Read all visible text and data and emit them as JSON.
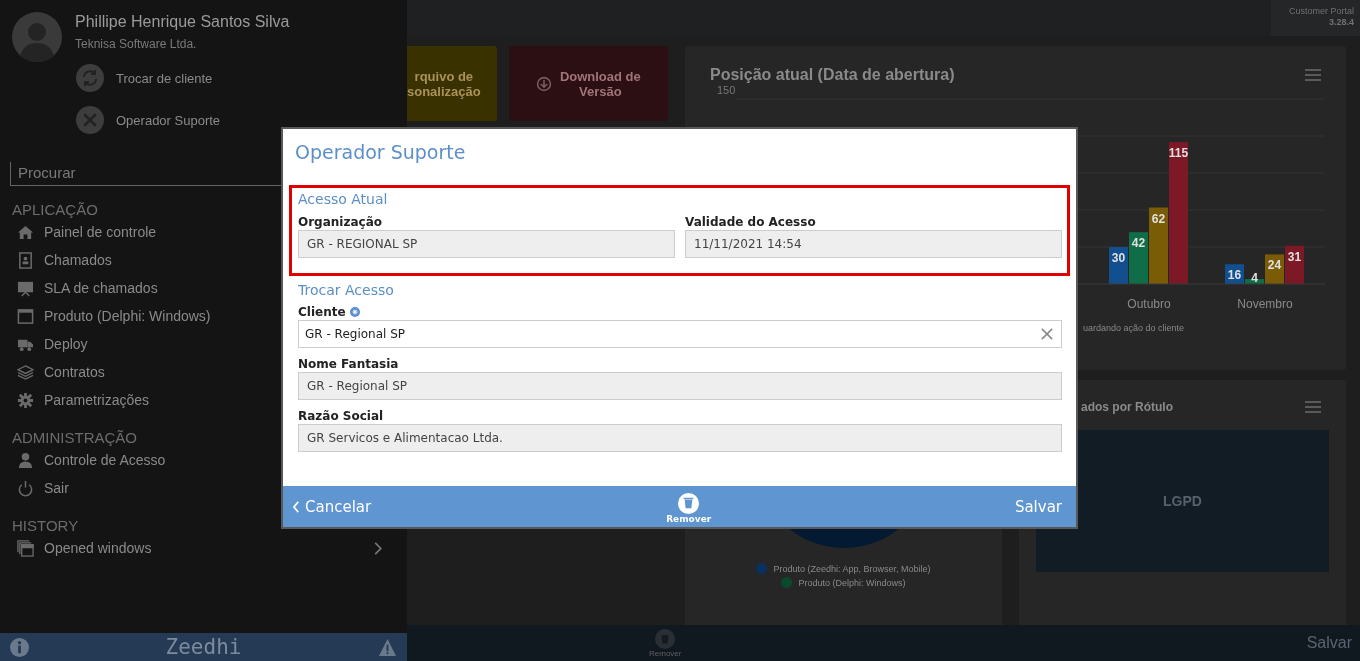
{
  "sidebar": {
    "user": {
      "name": "Phillipe Henrique Santos Silva",
      "company": "Teknisa Software Ltda."
    },
    "actions": [
      {
        "label": "Trocar de cliente"
      },
      {
        "label": "Operador Suporte"
      }
    ],
    "search": {
      "placeholder": "Procurar"
    },
    "sections": [
      {
        "title": "APLICAÇÃO",
        "items": [
          {
            "label": "Painel de controle"
          },
          {
            "label": "Chamados"
          },
          {
            "label": "SLA de chamados"
          },
          {
            "label": "Produto (Delphi: Windows)"
          },
          {
            "label": "Deploy"
          },
          {
            "label": "Contratos"
          },
          {
            "label": "Parametrizações"
          }
        ]
      },
      {
        "title": "ADMINISTRAÇÃO",
        "items": [
          {
            "label": "Controle de Acesso"
          },
          {
            "label": "Sair"
          }
        ]
      },
      {
        "title": "HISTORY",
        "items": [
          {
            "label": "Opened windows",
            "expandable": true
          }
        ]
      }
    ],
    "footer": {
      "logo": "Zeedhi"
    }
  },
  "header": {
    "app": "Customer Portal",
    "version": "3.28.4"
  },
  "tiles": [
    {
      "lines": [
        "rquivo de",
        "sonalização"
      ],
      "color": "#3a3100",
      "icon": false
    },
    {
      "lines": [
        "Download de",
        "Versão"
      ],
      "color": "#2c0f12",
      "icon": true
    }
  ],
  "position_card": {
    "title": "Posição atual (Data de abertura)",
    "axis_label": "150",
    "legend": "uardando ação do cliente",
    "chart_data": {
      "type": "bar",
      "categories": [
        "Outubro",
        "Novembro"
      ],
      "ylim": [
        0,
        150
      ],
      "data_labels": true,
      "series": [
        {
          "color": "#124f8f",
          "values": [
            30,
            16
          ]
        },
        {
          "color": "#0f6e47",
          "values": [
            42,
            4
          ]
        },
        {
          "color": "#7a5c06",
          "values": [
            62,
            24
          ]
        },
        {
          "color": "#7d1827",
          "values": [
            115,
            31
          ]
        }
      ]
    }
  },
  "donut_card": {
    "legend": [
      {
        "label": "Produto (Zeedhi: App, Browser, Mobile)",
        "color": "#0a3060"
      },
      {
        "label": "Produto (Delphi: Windows)",
        "color": "#0a4a2c"
      }
    ]
  },
  "label_card": {
    "title": "ados por Rótulo",
    "tile": "LGPD"
  },
  "bottom_bar": {
    "remove": "Remover",
    "save": "Salvar"
  },
  "modal": {
    "title": "Operador Suporte",
    "current": {
      "title": "Acesso Atual",
      "highlighted": true,
      "fields": [
        {
          "label": "Organização",
          "value": "GR - REGIONAL SP",
          "readonly": true
        },
        {
          "label": "Validade do Acesso",
          "value": "11/11/2021 14:54",
          "readonly": true
        }
      ]
    },
    "change": {
      "title": "Trocar Acesso",
      "fields": [
        {
          "label": "Cliente",
          "value": "GR - Regional SP",
          "readonly": false,
          "info": true,
          "clearable": true
        },
        {
          "label": "Nome Fantasia",
          "value": "GR - Regional SP",
          "readonly": true
        },
        {
          "label": "Razão Social",
          "value": "GR Servicos e Alimentacao Ltda.",
          "readonly": true
        }
      ]
    },
    "footer": {
      "cancel": "Cancelar",
      "remove": "Remover",
      "save": "Salvar"
    }
  }
}
